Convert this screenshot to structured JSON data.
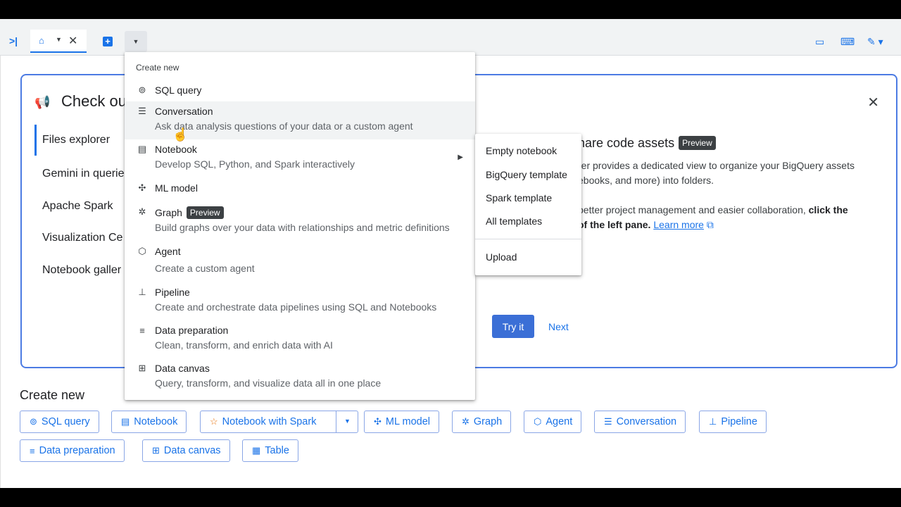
{
  "tabbar": {
    "home_tab_label": "",
    "icons": [
      "collapse-icon",
      "home-icon",
      "close-icon",
      "add-icon",
      "chevron-down-icon",
      "monitor-icon",
      "keyboard-icon",
      "edit-icon"
    ]
  },
  "card": {
    "title": "Check ou",
    "side_items": [
      "Files explorer",
      "Gemini in querie",
      "Apache Spark",
      "Visualization Ce",
      "Notebook galler"
    ],
    "feature_title": "hare code assets",
    "preview_badge": "Preview",
    "text_line1": "rer provides a dedicated view to organize your BigQuery assets",
    "text_line2": "ebooks, and more) into folders.",
    "text_line3a": "better project management and easier collaboration, ",
    "text_line3b": "click the",
    "text_line4": "of the left pane. ",
    "learn_more": "Learn more",
    "try_it": "Try it",
    "next": "Next"
  },
  "create_new": {
    "title": "Create new",
    "chips_row1": [
      {
        "label": "SQL query",
        "icon": "sql-icon"
      },
      {
        "label": "Notebook",
        "icon": "notebook-icon"
      },
      {
        "label": "Notebook with Spark",
        "icon": "spark-icon"
      },
      {
        "label": "ML model",
        "icon": "ml-icon"
      },
      {
        "label": "Graph",
        "icon": "graph-icon"
      },
      {
        "label": "Agent",
        "icon": "agent-icon"
      },
      {
        "label": "Conversation",
        "icon": "conversation-icon"
      },
      {
        "label": "Pipeline",
        "icon": "pipeline-icon"
      }
    ],
    "chips_row2": [
      {
        "label": "Data preparation",
        "icon": "data-prep-icon"
      },
      {
        "label": "Data canvas",
        "icon": "canvas-icon"
      },
      {
        "label": "Table",
        "icon": "table-icon"
      }
    ]
  },
  "menu": {
    "header": "Create new",
    "items": [
      {
        "label": "SQL query",
        "desc": ""
      },
      {
        "label": "Conversation",
        "desc": "Ask data analysis questions of your data or a custom agent"
      },
      {
        "label": "Notebook",
        "desc": "Develop SQL, Python, and Spark interactively"
      },
      {
        "label": "ML model",
        "desc": ""
      },
      {
        "label": "Graph",
        "desc": "Build graphs over your data with relationships and metric definitions",
        "badge": "Preview"
      },
      {
        "label": "Agent",
        "desc": "Create a custom agent"
      },
      {
        "label": "Pipeline",
        "desc": "Create and orchestrate data pipelines using SQL and Notebooks"
      },
      {
        "label": "Data preparation",
        "desc": "Clean, transform, and enrich data with AI"
      },
      {
        "label": "Data canvas",
        "desc": "Query, transform, and visualize data all in one place"
      }
    ]
  },
  "submenu": {
    "items": [
      "Empty notebook",
      "BigQuery template",
      "Spark template",
      "All templates"
    ],
    "upload": "Upload"
  },
  "colors": {
    "accent": "#1a73e8",
    "button": "#3b6fd6",
    "badge": "#3c4043"
  }
}
